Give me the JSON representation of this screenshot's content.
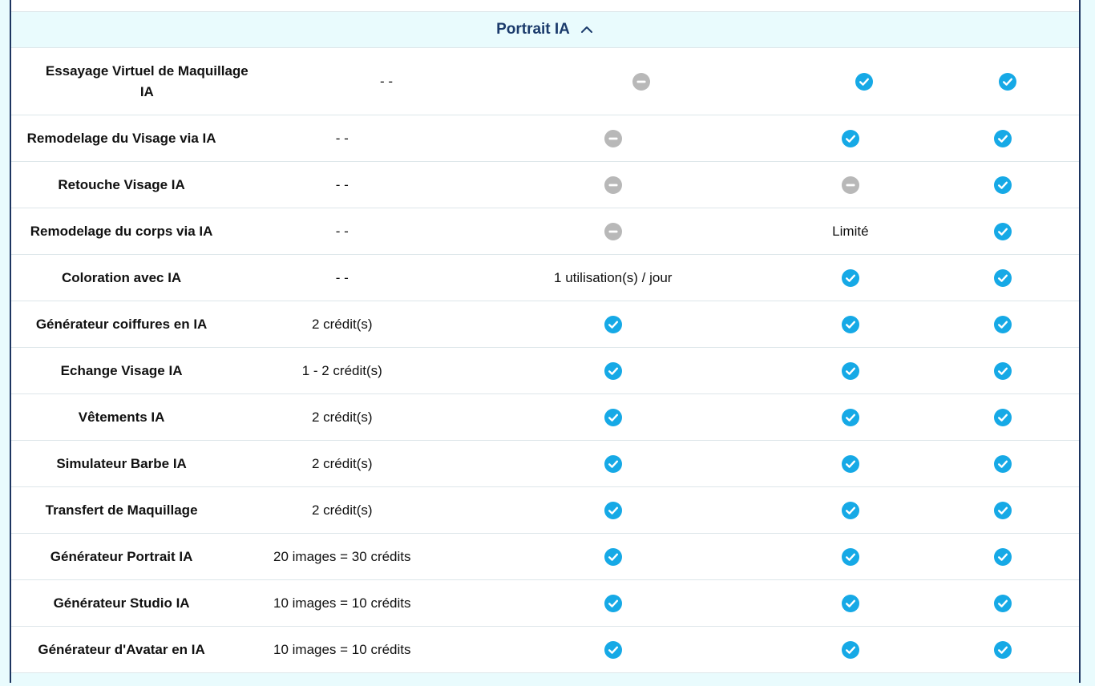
{
  "section": {
    "title": "Portrait IA",
    "toggle_icon": "chevron-up-icon"
  },
  "colors": {
    "check": "#16a9e6",
    "unavailable": "#b8b8b8",
    "header_bg": "#e9fbfd",
    "title": "#1a3a6b"
  },
  "rows": [
    {
      "feature": "Essayage Virtuel de Maquillage IA",
      "credits": "- -",
      "c2": {
        "type": "no"
      },
      "c3": {
        "type": "check"
      },
      "c4": {
        "type": "check"
      }
    },
    {
      "feature": "Remodelage du Visage via IA",
      "credits": "- -",
      "c2": {
        "type": "no"
      },
      "c3": {
        "type": "check"
      },
      "c4": {
        "type": "check"
      }
    },
    {
      "feature": "Retouche Visage IA",
      "credits": "- -",
      "c2": {
        "type": "no"
      },
      "c3": {
        "type": "no"
      },
      "c4": {
        "type": "check"
      }
    },
    {
      "feature": "Remodelage du corps via IA",
      "credits": "- -",
      "c2": {
        "type": "no"
      },
      "c3": {
        "type": "text",
        "text": "Limité"
      },
      "c4": {
        "type": "check"
      }
    },
    {
      "feature": "Coloration avec IA",
      "credits": "- -",
      "c2": {
        "type": "text",
        "text": "1 utilisation(s) / jour"
      },
      "c3": {
        "type": "check"
      },
      "c4": {
        "type": "check"
      }
    },
    {
      "feature": "Générateur coiffures en IA",
      "credits": "2 crédit(s)",
      "c2": {
        "type": "check"
      },
      "c3": {
        "type": "check"
      },
      "c4": {
        "type": "check"
      }
    },
    {
      "feature": "Echange Visage IA",
      "credits": "1 - 2 crédit(s)",
      "c2": {
        "type": "check"
      },
      "c3": {
        "type": "check"
      },
      "c4": {
        "type": "check"
      }
    },
    {
      "feature": "Vêtements IA",
      "credits": "2 crédit(s)",
      "c2": {
        "type": "check"
      },
      "c3": {
        "type": "check"
      },
      "c4": {
        "type": "check"
      }
    },
    {
      "feature": "Simulateur Barbe IA",
      "credits": "2 crédit(s)",
      "c2": {
        "type": "check"
      },
      "c3": {
        "type": "check"
      },
      "c4": {
        "type": "check"
      }
    },
    {
      "feature": "Transfert de Maquillage",
      "credits": "2 crédit(s)",
      "c2": {
        "type": "check"
      },
      "c3": {
        "type": "check"
      },
      "c4": {
        "type": "check"
      }
    },
    {
      "feature": "Générateur Portrait IA",
      "credits": "20 images = 30 crédits",
      "c2": {
        "type": "check"
      },
      "c3": {
        "type": "check"
      },
      "c4": {
        "type": "check"
      }
    },
    {
      "feature": "Générateur Studio IA",
      "credits": "10 images = 10 crédits",
      "c2": {
        "type": "check"
      },
      "c3": {
        "type": "check"
      },
      "c4": {
        "type": "check"
      }
    },
    {
      "feature": "Générateur d'Avatar en IA",
      "credits": "10 images = 10 crédits",
      "c2": {
        "type": "check"
      },
      "c3": {
        "type": "check"
      },
      "c4": {
        "type": "check"
      }
    }
  ]
}
